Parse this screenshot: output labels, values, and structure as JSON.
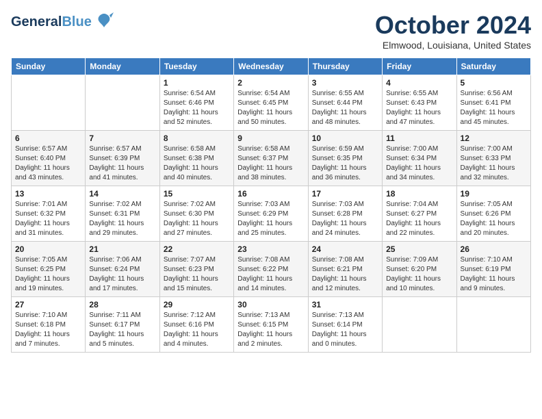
{
  "logo": {
    "general": "General",
    "blue": "Blue",
    "tagline": ""
  },
  "header": {
    "month_year": "October 2024",
    "location": "Elmwood, Louisiana, United States"
  },
  "weekdays": [
    "Sunday",
    "Monday",
    "Tuesday",
    "Wednesday",
    "Thursday",
    "Friday",
    "Saturday"
  ],
  "weeks": [
    [
      {
        "day": "",
        "detail": ""
      },
      {
        "day": "",
        "detail": ""
      },
      {
        "day": "1",
        "detail": "Sunrise: 6:54 AM\nSunset: 6:46 PM\nDaylight: 11 hours\nand 52 minutes."
      },
      {
        "day": "2",
        "detail": "Sunrise: 6:54 AM\nSunset: 6:45 PM\nDaylight: 11 hours\nand 50 minutes."
      },
      {
        "day": "3",
        "detail": "Sunrise: 6:55 AM\nSunset: 6:44 PM\nDaylight: 11 hours\nand 48 minutes."
      },
      {
        "day": "4",
        "detail": "Sunrise: 6:55 AM\nSunset: 6:43 PM\nDaylight: 11 hours\nand 47 minutes."
      },
      {
        "day": "5",
        "detail": "Sunrise: 6:56 AM\nSunset: 6:41 PM\nDaylight: 11 hours\nand 45 minutes."
      }
    ],
    [
      {
        "day": "6",
        "detail": "Sunrise: 6:57 AM\nSunset: 6:40 PM\nDaylight: 11 hours\nand 43 minutes."
      },
      {
        "day": "7",
        "detail": "Sunrise: 6:57 AM\nSunset: 6:39 PM\nDaylight: 11 hours\nand 41 minutes."
      },
      {
        "day": "8",
        "detail": "Sunrise: 6:58 AM\nSunset: 6:38 PM\nDaylight: 11 hours\nand 40 minutes."
      },
      {
        "day": "9",
        "detail": "Sunrise: 6:58 AM\nSunset: 6:37 PM\nDaylight: 11 hours\nand 38 minutes."
      },
      {
        "day": "10",
        "detail": "Sunrise: 6:59 AM\nSunset: 6:35 PM\nDaylight: 11 hours\nand 36 minutes."
      },
      {
        "day": "11",
        "detail": "Sunrise: 7:00 AM\nSunset: 6:34 PM\nDaylight: 11 hours\nand 34 minutes."
      },
      {
        "day": "12",
        "detail": "Sunrise: 7:00 AM\nSunset: 6:33 PM\nDaylight: 11 hours\nand 32 minutes."
      }
    ],
    [
      {
        "day": "13",
        "detail": "Sunrise: 7:01 AM\nSunset: 6:32 PM\nDaylight: 11 hours\nand 31 minutes."
      },
      {
        "day": "14",
        "detail": "Sunrise: 7:02 AM\nSunset: 6:31 PM\nDaylight: 11 hours\nand 29 minutes."
      },
      {
        "day": "15",
        "detail": "Sunrise: 7:02 AM\nSunset: 6:30 PM\nDaylight: 11 hours\nand 27 minutes."
      },
      {
        "day": "16",
        "detail": "Sunrise: 7:03 AM\nSunset: 6:29 PM\nDaylight: 11 hours\nand 25 minutes."
      },
      {
        "day": "17",
        "detail": "Sunrise: 7:03 AM\nSunset: 6:28 PM\nDaylight: 11 hours\nand 24 minutes."
      },
      {
        "day": "18",
        "detail": "Sunrise: 7:04 AM\nSunset: 6:27 PM\nDaylight: 11 hours\nand 22 minutes."
      },
      {
        "day": "19",
        "detail": "Sunrise: 7:05 AM\nSunset: 6:26 PM\nDaylight: 11 hours\nand 20 minutes."
      }
    ],
    [
      {
        "day": "20",
        "detail": "Sunrise: 7:05 AM\nSunset: 6:25 PM\nDaylight: 11 hours\nand 19 minutes."
      },
      {
        "day": "21",
        "detail": "Sunrise: 7:06 AM\nSunset: 6:24 PM\nDaylight: 11 hours\nand 17 minutes."
      },
      {
        "day": "22",
        "detail": "Sunrise: 7:07 AM\nSunset: 6:23 PM\nDaylight: 11 hours\nand 15 minutes."
      },
      {
        "day": "23",
        "detail": "Sunrise: 7:08 AM\nSunset: 6:22 PM\nDaylight: 11 hours\nand 14 minutes."
      },
      {
        "day": "24",
        "detail": "Sunrise: 7:08 AM\nSunset: 6:21 PM\nDaylight: 11 hours\nand 12 minutes."
      },
      {
        "day": "25",
        "detail": "Sunrise: 7:09 AM\nSunset: 6:20 PM\nDaylight: 11 hours\nand 10 minutes."
      },
      {
        "day": "26",
        "detail": "Sunrise: 7:10 AM\nSunset: 6:19 PM\nDaylight: 11 hours\nand 9 minutes."
      }
    ],
    [
      {
        "day": "27",
        "detail": "Sunrise: 7:10 AM\nSunset: 6:18 PM\nDaylight: 11 hours\nand 7 minutes."
      },
      {
        "day": "28",
        "detail": "Sunrise: 7:11 AM\nSunset: 6:17 PM\nDaylight: 11 hours\nand 5 minutes."
      },
      {
        "day": "29",
        "detail": "Sunrise: 7:12 AM\nSunset: 6:16 PM\nDaylight: 11 hours\nand 4 minutes."
      },
      {
        "day": "30",
        "detail": "Sunrise: 7:13 AM\nSunset: 6:15 PM\nDaylight: 11 hours\nand 2 minutes."
      },
      {
        "day": "31",
        "detail": "Sunrise: 7:13 AM\nSunset: 6:14 PM\nDaylight: 11 hours\nand 0 minutes."
      },
      {
        "day": "",
        "detail": ""
      },
      {
        "day": "",
        "detail": ""
      }
    ]
  ]
}
